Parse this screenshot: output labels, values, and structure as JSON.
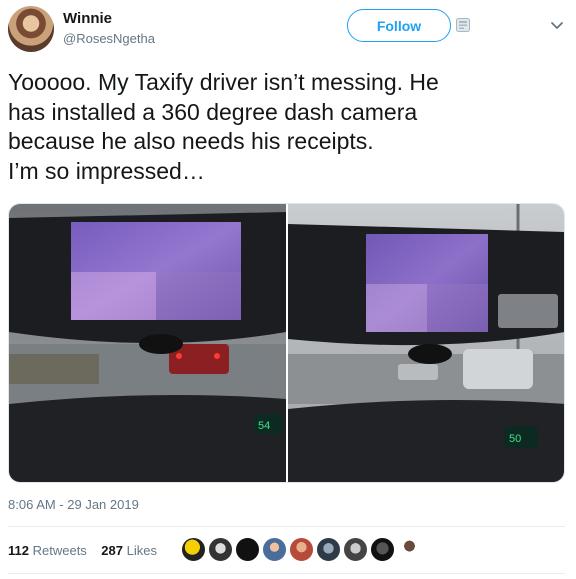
{
  "author": {
    "display_name": "Winnie",
    "handle": "@RosesNgetha"
  },
  "actions": {
    "follow_label": "Follow"
  },
  "tweet": {
    "text": "Yooooo. My Taxify driver isn’t messing. He\nhas installed a 360 degree dash camera\nbecause he also needs his receipts.\nI’m so impressed…",
    "timestamp": "8:06 AM - 29 Jan 2019"
  },
  "stats": {
    "retweets_count": "112",
    "retweets_label": "Retweets",
    "likes_count": "287",
    "likes_label": "Likes"
  },
  "colors": {
    "accent": "#1da1f2",
    "secondary_text": "#657786",
    "primary_text": "#14171a"
  },
  "icons": {
    "app": "tweetdeck-icon",
    "menu": "chevron-down-icon"
  },
  "media": {
    "left_photo_speed_readout": "54",
    "right_photo_speed_readout": "50"
  }
}
